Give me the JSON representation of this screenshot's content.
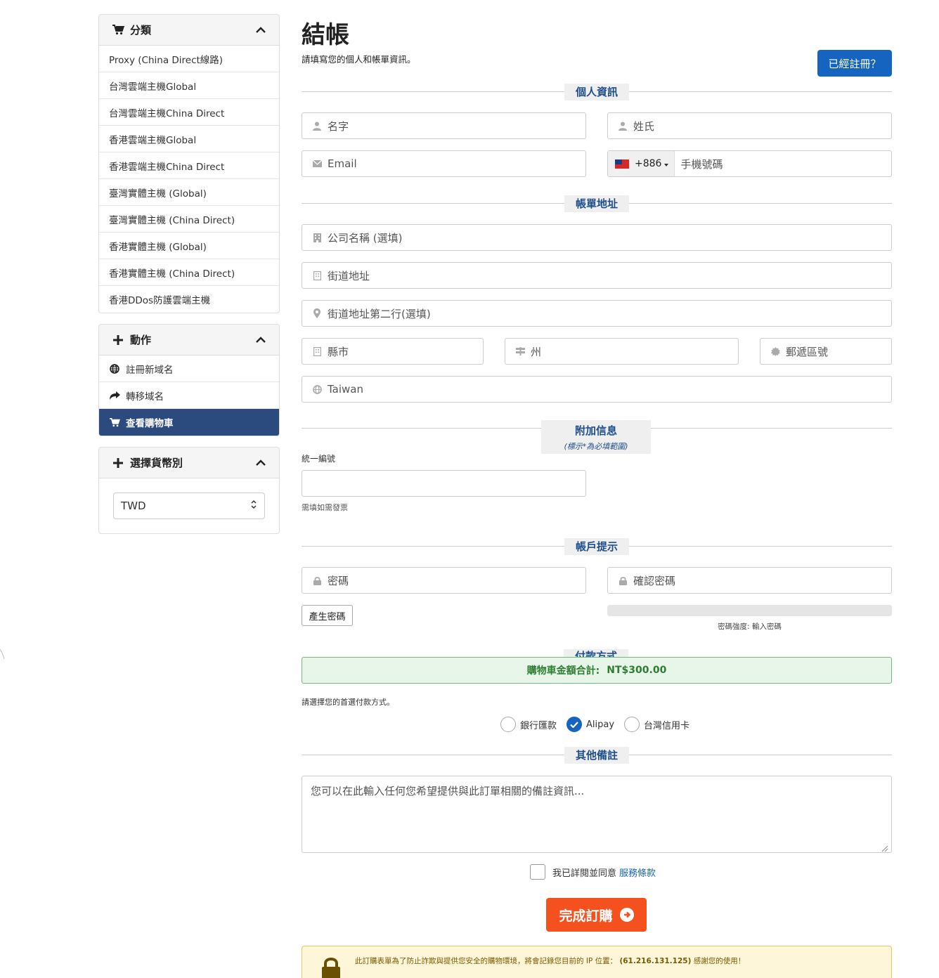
{
  "sidebar": {
    "categories": {
      "title": "分類",
      "items": [
        "Proxy (China Direct線路)",
        "台灣雲端主機Global",
        "台灣雲端主機China Direct",
        "香港雲端主機Global",
        "香港雲端主機China Direct",
        "臺灣實體主機 (Global)",
        "臺灣實體主機 (China Direct)",
        "香港實體主機 (Global)",
        "香港實體主機 (China Direct)",
        "香港DDos防護雲端主機"
      ]
    },
    "actions": {
      "title": "動作",
      "items": [
        {
          "label": "註冊新域名",
          "icon": "globe-icon"
        },
        {
          "label": "轉移域名",
          "icon": "share-icon"
        },
        {
          "label": "查看購物車",
          "icon": "cart-icon",
          "active": true
        }
      ]
    },
    "currency": {
      "title": "選擇貨幣別",
      "selected": "TWD"
    }
  },
  "main": {
    "title": "結帳",
    "subtitle": "請填寫您的個人和帳單資訊。",
    "registered_button": "已經註冊？",
    "sections": {
      "personal": "個人資訊",
      "billing": "帳單地址",
      "extra": "附加信息",
      "extra_note": "(標示*為必填範圍)",
      "account": "帳戶提示",
      "payment": "付款方式",
      "notes": "其他備註"
    },
    "fields": {
      "first_name": "名字",
      "last_name": "姓氏",
      "email": "Email",
      "phone_code": "+886",
      "phone": "手機號碼",
      "company": "公司名稱 (選填)",
      "street": "街道地址",
      "street2": "街道地址第二行(選填)",
      "city": "縣市",
      "state": "州",
      "postcode": "郵遞區號",
      "country": "Taiwan",
      "tax_id_label": "統一編號",
      "tax_id_value": "",
      "tax_id_help": "需填如需發票",
      "password": "密碼",
      "confirm_password": "確認密碼",
      "generate_password": "產生密碼",
      "strength": "密碼強度: 輸入密碼"
    },
    "payment": {
      "total_label": "購物車金額合計:",
      "total_value": "NT$300.00",
      "prompt": "請選擇您的首選付款方式。",
      "options": [
        {
          "label": "銀行匯款",
          "checked": false
        },
        {
          "label": "Alipay",
          "checked": true
        },
        {
          "label": "台灣信用卡",
          "checked": false
        }
      ]
    },
    "notes_placeholder": "您可以在此輸入任何您希望提供與此訂單相關的備註資訊...",
    "agree_text": "我已詳閱並同意",
    "terms_link": "服務條款",
    "submit": "完成訂購",
    "security_msg": "此訂購表單為了防止詐欺與提供您安全的購物環境，將會記錄您目前的 IP 位置：",
    "security_ip": "(61.216.131.125)",
    "security_thanks": "感謝您的使用！"
  },
  "colors": {
    "primary": "#1565c0",
    "sidebar_active": "#2b4a7d",
    "submit": "#f4511e",
    "success_bg": "#e8f6ea",
    "warning_bg": "#fdf6d8"
  }
}
